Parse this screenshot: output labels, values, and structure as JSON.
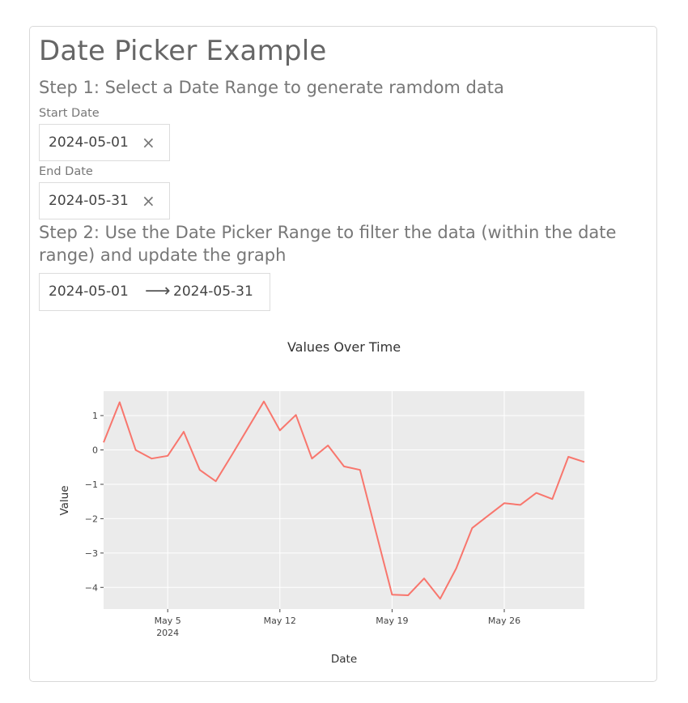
{
  "page": {
    "title": "Date Picker Example",
    "step1": "Step 1: Select a Date Range to generate ramdom data",
    "step2": "Step 2: Use the Date Picker Range to filter the data (within the date range) and update the graph"
  },
  "start_date": {
    "label": "Start Date",
    "value": "2024-05-01",
    "clear_glyph": "×"
  },
  "end_date": {
    "label": "End Date",
    "value": "2024-05-31",
    "clear_glyph": "×"
  },
  "range_picker": {
    "start": "2024-05-01",
    "end": "2024-05-31",
    "arrow_glyph": "⟶"
  },
  "chart_data": {
    "type": "line",
    "title": "Values Over Time",
    "xlabel": "Date",
    "ylabel": "Value",
    "x": [
      "2024-05-01",
      "2024-05-02",
      "2024-05-03",
      "2024-05-04",
      "2024-05-05",
      "2024-05-06",
      "2024-05-07",
      "2024-05-08",
      "2024-05-09",
      "2024-05-10",
      "2024-05-11",
      "2024-05-12",
      "2024-05-13",
      "2024-05-14",
      "2024-05-15",
      "2024-05-16",
      "2024-05-17",
      "2024-05-18",
      "2024-05-19",
      "2024-05-20",
      "2024-05-21",
      "2024-05-22",
      "2024-05-23",
      "2024-05-24",
      "2024-05-25",
      "2024-05-26",
      "2024-05-27",
      "2024-05-28",
      "2024-05-29",
      "2024-05-30",
      "2024-05-31"
    ],
    "y": [
      0.22,
      1.39,
      0.0,
      -0.25,
      -0.17,
      0.53,
      -0.58,
      -0.91,
      -0.15,
      0.63,
      1.41,
      0.57,
      1.02,
      -0.25,
      0.13,
      -0.48,
      -0.58,
      -2.4,
      -4.21,
      -4.23,
      -3.74,
      -4.33,
      -3.45,
      -2.27,
      -1.91,
      -1.55,
      -1.6,
      -1.25,
      -1.43,
      -0.2,
      -0.35
    ],
    "xticks": [
      {
        "value": "2024-05-05",
        "label": "May 5",
        "sublabel": "2024"
      },
      {
        "value": "2024-05-12",
        "label": "May 12",
        "sublabel": ""
      },
      {
        "value": "2024-05-19",
        "label": "May 19",
        "sublabel": ""
      },
      {
        "value": "2024-05-26",
        "label": "May 26",
        "sublabel": ""
      }
    ],
    "yticks": [
      1,
      0,
      -1,
      -2,
      -3,
      -4
    ],
    "ytick_labels": [
      "1",
      "0",
      "−1",
      "−2",
      "−3",
      "−4"
    ],
    "ylim": [
      -4.63,
      1.71
    ],
    "xlim": [
      "2024-05-01",
      "2024-05-31"
    ],
    "grid": true,
    "line_color": "#F8766D",
    "background_color": "#EBEBEB"
  }
}
